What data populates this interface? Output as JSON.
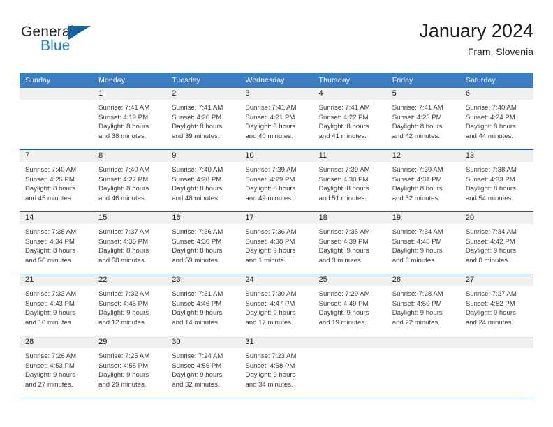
{
  "brand": {
    "name_top": "General",
    "name_bottom": "Blue",
    "triangle_icon": "triangle-icon",
    "colors": {
      "black": "#231f20",
      "blue": "#2180c4",
      "triangle": "#1464a5"
    }
  },
  "header": {
    "title": "January 2024",
    "subtitle": "Fram, Slovenia"
  },
  "calendar": {
    "header_bg": "#3b7dc0",
    "row_rule": "#1f5fa8",
    "daynum_bg": "#f0f0f0",
    "weekdays": [
      "Sunday",
      "Monday",
      "Tuesday",
      "Wednesday",
      "Thursday",
      "Friday",
      "Saturday"
    ],
    "weeks": [
      [
        {
          "day": "",
          "lines": []
        },
        {
          "day": "1",
          "lines": [
            "Sunrise: 7:41 AM",
            "Sunset: 4:19 PM",
            "Daylight: 8 hours",
            "and 38 minutes."
          ]
        },
        {
          "day": "2",
          "lines": [
            "Sunrise: 7:41 AM",
            "Sunset: 4:20 PM",
            "Daylight: 8 hours",
            "and 39 minutes."
          ]
        },
        {
          "day": "3",
          "lines": [
            "Sunrise: 7:41 AM",
            "Sunset: 4:21 PM",
            "Daylight: 8 hours",
            "and 40 minutes."
          ]
        },
        {
          "day": "4",
          "lines": [
            "Sunrise: 7:41 AM",
            "Sunset: 4:22 PM",
            "Daylight: 8 hours",
            "and 41 minutes."
          ]
        },
        {
          "day": "5",
          "lines": [
            "Sunrise: 7:41 AM",
            "Sunset: 4:23 PM",
            "Daylight: 8 hours",
            "and 42 minutes."
          ]
        },
        {
          "day": "6",
          "lines": [
            "Sunrise: 7:40 AM",
            "Sunset: 4:24 PM",
            "Daylight: 8 hours",
            "and 44 minutes."
          ]
        }
      ],
      [
        {
          "day": "7",
          "lines": [
            "Sunrise: 7:40 AM",
            "Sunset: 4:25 PM",
            "Daylight: 8 hours",
            "and 45 minutes."
          ]
        },
        {
          "day": "8",
          "lines": [
            "Sunrise: 7:40 AM",
            "Sunset: 4:27 PM",
            "Daylight: 8 hours",
            "and 46 minutes."
          ]
        },
        {
          "day": "9",
          "lines": [
            "Sunrise: 7:40 AM",
            "Sunset: 4:28 PM",
            "Daylight: 8 hours",
            "and 48 minutes."
          ]
        },
        {
          "day": "10",
          "lines": [
            "Sunrise: 7:39 AM",
            "Sunset: 4:29 PM",
            "Daylight: 8 hours",
            "and 49 minutes."
          ]
        },
        {
          "day": "11",
          "lines": [
            "Sunrise: 7:39 AM",
            "Sunset: 4:30 PM",
            "Daylight: 8 hours",
            "and 51 minutes."
          ]
        },
        {
          "day": "12",
          "lines": [
            "Sunrise: 7:39 AM",
            "Sunset: 4:31 PM",
            "Daylight: 8 hours",
            "and 52 minutes."
          ]
        },
        {
          "day": "13",
          "lines": [
            "Sunrise: 7:38 AM",
            "Sunset: 4:33 PM",
            "Daylight: 8 hours",
            "and 54 minutes."
          ]
        }
      ],
      [
        {
          "day": "14",
          "lines": [
            "Sunrise: 7:38 AM",
            "Sunset: 4:34 PM",
            "Daylight: 8 hours",
            "and 56 minutes."
          ]
        },
        {
          "day": "15",
          "lines": [
            "Sunrise: 7:37 AM",
            "Sunset: 4:35 PM",
            "Daylight: 8 hours",
            "and 58 minutes."
          ]
        },
        {
          "day": "16",
          "lines": [
            "Sunrise: 7:36 AM",
            "Sunset: 4:36 PM",
            "Daylight: 8 hours",
            "and 59 minutes."
          ]
        },
        {
          "day": "17",
          "lines": [
            "Sunrise: 7:36 AM",
            "Sunset: 4:38 PM",
            "Daylight: 9 hours",
            "and 1 minute."
          ]
        },
        {
          "day": "18",
          "lines": [
            "Sunrise: 7:35 AM",
            "Sunset: 4:39 PM",
            "Daylight: 9 hours",
            "and 3 minutes."
          ]
        },
        {
          "day": "19",
          "lines": [
            "Sunrise: 7:34 AM",
            "Sunset: 4:40 PM",
            "Daylight: 9 hours",
            "and 6 minutes."
          ]
        },
        {
          "day": "20",
          "lines": [
            "Sunrise: 7:34 AM",
            "Sunset: 4:42 PM",
            "Daylight: 9 hours",
            "and 8 minutes."
          ]
        }
      ],
      [
        {
          "day": "21",
          "lines": [
            "Sunrise: 7:33 AM",
            "Sunset: 4:43 PM",
            "Daylight: 9 hours",
            "and 10 minutes."
          ]
        },
        {
          "day": "22",
          "lines": [
            "Sunrise: 7:32 AM",
            "Sunset: 4:45 PM",
            "Daylight: 9 hours",
            "and 12 minutes."
          ]
        },
        {
          "day": "23",
          "lines": [
            "Sunrise: 7:31 AM",
            "Sunset: 4:46 PM",
            "Daylight: 9 hours",
            "and 14 minutes."
          ]
        },
        {
          "day": "24",
          "lines": [
            "Sunrise: 7:30 AM",
            "Sunset: 4:47 PM",
            "Daylight: 9 hours",
            "and 17 minutes."
          ]
        },
        {
          "day": "25",
          "lines": [
            "Sunrise: 7:29 AM",
            "Sunset: 4:49 PM",
            "Daylight: 9 hours",
            "and 19 minutes."
          ]
        },
        {
          "day": "26",
          "lines": [
            "Sunrise: 7:28 AM",
            "Sunset: 4:50 PM",
            "Daylight: 9 hours",
            "and 22 minutes."
          ]
        },
        {
          "day": "27",
          "lines": [
            "Sunrise: 7:27 AM",
            "Sunset: 4:52 PM",
            "Daylight: 9 hours",
            "and 24 minutes."
          ]
        }
      ],
      [
        {
          "day": "28",
          "lines": [
            "Sunrise: 7:26 AM",
            "Sunset: 4:53 PM",
            "Daylight: 9 hours",
            "and 27 minutes."
          ]
        },
        {
          "day": "29",
          "lines": [
            "Sunrise: 7:25 AM",
            "Sunset: 4:55 PM",
            "Daylight: 9 hours",
            "and 29 minutes."
          ]
        },
        {
          "day": "30",
          "lines": [
            "Sunrise: 7:24 AM",
            "Sunset: 4:56 PM",
            "Daylight: 9 hours",
            "and 32 minutes."
          ]
        },
        {
          "day": "31",
          "lines": [
            "Sunrise: 7:23 AM",
            "Sunset: 4:58 PM",
            "Daylight: 9 hours",
            "and 34 minutes."
          ]
        },
        {
          "day": "",
          "lines": []
        },
        {
          "day": "",
          "lines": []
        },
        {
          "day": "",
          "lines": []
        }
      ]
    ]
  }
}
